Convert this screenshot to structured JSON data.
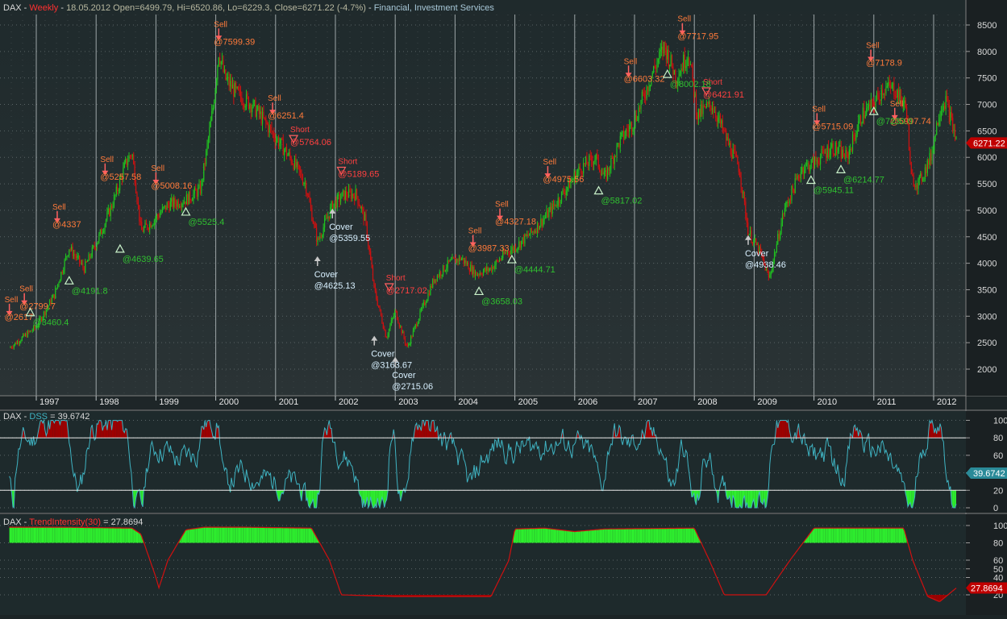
{
  "colors": {
    "up": "#20c020",
    "down": "#d01010",
    "sig": "#ff7a3a",
    "cov": "#d8f0ff",
    "buy": "#30c030",
    "dss": "#3fb3c2",
    "ti": "#d01010",
    "fill_hi": "#a00000",
    "fill_lo": "#2ef02e",
    "bg": "#1c2426"
  },
  "header": {
    "symbol": "DAX",
    "interval": "Weekly",
    "quote": "18.05.2012 Open=6499.79, Hi=6520.86, Lo=6229.3, Close=6271.22 (-4.7%)",
    "sector": "Financial, Investment Services"
  },
  "last_price": "6271.22",
  "chart_data": [
    {
      "type": "candlestick",
      "title": "DAX - Weekly",
      "x_years": [
        "1997",
        "1998",
        "1999",
        "2000",
        "2001",
        "2002",
        "2003",
        "2004",
        "2005",
        "2006",
        "2007",
        "2008",
        "2009",
        "2010",
        "2011",
        "2012"
      ],
      "ylim": [
        1500,
        8800
      ],
      "yticks": [
        2000,
        2500,
        3000,
        3500,
        4000,
        4500,
        5000,
        5500,
        6000,
        6500,
        7000,
        7500,
        8000,
        8500
      ],
      "price_path": [
        [
          1996.55,
          2400
        ],
        [
          1997.0,
          2800
        ],
        [
          1997.3,
          3400
        ],
        [
          1997.55,
          4300
        ],
        [
          1997.8,
          3900
        ],
        [
          1998.05,
          4500
        ],
        [
          1998.3,
          5200
        ],
        [
          1998.5,
          5900
        ],
        [
          1998.6,
          6100
        ],
        [
          1998.75,
          4600
        ],
        [
          1998.95,
          4800
        ],
        [
          1999.2,
          5100
        ],
        [
          1999.5,
          5200
        ],
        [
          1999.75,
          5400
        ],
        [
          1999.95,
          6900
        ],
        [
          2000.05,
          8000
        ],
        [
          2000.15,
          7500
        ],
        [
          2000.35,
          7200
        ],
        [
          2000.6,
          7000
        ],
        [
          2000.8,
          6700
        ],
        [
          2001.05,
          6300
        ],
        [
          2001.3,
          5900
        ],
        [
          2001.5,
          5500
        ],
        [
          2001.7,
          4400
        ],
        [
          2001.95,
          5100
        ],
        [
          2002.15,
          5300
        ],
        [
          2002.35,
          5300
        ],
        [
          2002.5,
          4800
        ],
        [
          2002.65,
          3500
        ],
        [
          2002.85,
          2600
        ],
        [
          2003.0,
          3100
        ],
        [
          2003.2,
          2400
        ],
        [
          2003.4,
          3000
        ],
        [
          2003.65,
          3700
        ],
        [
          2003.9,
          4000
        ],
        [
          2004.1,
          4100
        ],
        [
          2004.35,
          3800
        ],
        [
          2004.6,
          3900
        ],
        [
          2004.85,
          4200
        ],
        [
          2005.0,
          4300
        ],
        [
          2005.3,
          4600
        ],
        [
          2005.6,
          5000
        ],
        [
          2005.85,
          5400
        ],
        [
          2006.1,
          5800
        ],
        [
          2006.35,
          6000
        ],
        [
          2006.5,
          5600
        ],
        [
          2006.75,
          6300
        ],
        [
          2007.0,
          6700
        ],
        [
          2007.3,
          7600
        ],
        [
          2007.5,
          8100
        ],
        [
          2007.7,
          7500
        ],
        [
          2007.9,
          8000
        ],
        [
          2008.05,
          6800
        ],
        [
          2008.3,
          7000
        ],
        [
          2008.55,
          6300
        ],
        [
          2008.75,
          5800
        ],
        [
          2008.9,
          4600
        ],
        [
          2009.1,
          4200
        ],
        [
          2009.25,
          3700
        ],
        [
          2009.5,
          5000
        ],
        [
          2009.8,
          5800
        ],
        [
          2010.0,
          5900
        ],
        [
          2010.3,
          6200
        ],
        [
          2010.55,
          6000
        ],
        [
          2010.8,
          6800
        ],
        [
          2011.0,
          7000
        ],
        [
          2011.15,
          7300
        ],
        [
          2011.35,
          7300
        ],
        [
          2011.55,
          6900
        ],
        [
          2011.62,
          5600
        ],
        [
          2011.75,
          5500
        ],
        [
          2011.95,
          6000
        ],
        [
          2012.1,
          6900
        ],
        [
          2012.2,
          7100
        ],
        [
          2012.38,
          6300
        ]
      ],
      "signals": [
        {
          "kind": "sell",
          "label": "Sell",
          "price": "@7599.39",
          "x": 2000.05,
          "y": 8100
        },
        {
          "kind": "sell",
          "label": "Sell",
          "price": "@6251.4",
          "x": 2000.95,
          "y": 6700
        },
        {
          "kind": "sell",
          "label": "Sell",
          "price": "@5257.58",
          "x": 1998.15,
          "y": 5550
        },
        {
          "kind": "sell",
          "label": "Sell",
          "price": "@5008.16",
          "x": 1999.0,
          "y": 5380
        },
        {
          "kind": "sell",
          "label": "Sell",
          "price": "@4337",
          "x": 1997.35,
          "y": 4650
        },
        {
          "kind": "sell",
          "label": "Sell",
          "price": "@2799.7",
          "x": 1996.8,
          "y": 3100
        },
        {
          "kind": "sell",
          "label": "Sell",
          "price": "@2617",
          "x": 1996.55,
          "y": 2900
        },
        {
          "kind": "short",
          "label": "Short",
          "price": "@5764.06",
          "x": 2001.3,
          "y": 6200
        },
        {
          "kind": "short",
          "label": "Short",
          "price": "@5189.65",
          "x": 2002.1,
          "y": 5600
        },
        {
          "kind": "short",
          "label": "Short",
          "price": "@2717.02",
          "x": 2002.9,
          "y": 3400
        },
        {
          "kind": "sell",
          "label": "Sell",
          "price": "@3987.33",
          "x": 2004.3,
          "y": 4200
        },
        {
          "kind": "sell",
          "label": "Sell",
          "price": "@4327.18",
          "x": 2004.75,
          "y": 4700
        },
        {
          "kind": "sell",
          "label": "Sell",
          "price": "@4975.56",
          "x": 2005.55,
          "y": 5500
        },
        {
          "kind": "sell",
          "label": "Sell",
          "price": "@6603.32",
          "x": 2006.9,
          "y": 7400
        },
        {
          "kind": "sell",
          "label": "Sell",
          "price": "@7717.95",
          "x": 2007.8,
          "y": 8200
        },
        {
          "kind": "short",
          "label": "Short",
          "price": "@6421.91",
          "x": 2008.2,
          "y": 7100
        },
        {
          "kind": "sell",
          "label": "Sell",
          "price": "@5715.09",
          "x": 2010.05,
          "y": 6500
        },
        {
          "kind": "sell",
          "label": "Sell",
          "price": "@7178.9",
          "x": 2010.95,
          "y": 7700
        },
        {
          "kind": "sell",
          "label": "Sell",
          "price": "@5997.74",
          "x": 2011.35,
          "y": 6600
        },
        {
          "kind": "buy",
          "label": "Buy",
          "price": "@3460.4",
          "x": 1996.9,
          "y": 3100
        },
        {
          "kind": "buy",
          "label": "Buy",
          "price": "@4191.8",
          "x": 1997.55,
          "y": 3700
        },
        {
          "kind": "buy",
          "label": "Buy",
          "price": "@4639.65",
          "x": 1998.4,
          "y": 4300
        },
        {
          "kind": "buy",
          "label": "Buy",
          "price": "@5525.4",
          "x": 1999.5,
          "y": 5000
        },
        {
          "kind": "buy",
          "label": "Buy",
          "price": "@3658.03",
          "x": 2004.4,
          "y": 3500
        },
        {
          "kind": "buy",
          "label": "Buy",
          "price": "@4444.71",
          "x": 2004.95,
          "y": 4100
        },
        {
          "kind": "buy",
          "label": "Buy",
          "price": "@5817.02",
          "x": 2006.4,
          "y": 5400
        },
        {
          "kind": "buy",
          "label": "Buy",
          "price": "@8002.18",
          "x": 2007.55,
          "y": 7600
        },
        {
          "kind": "buy",
          "label": "Buy",
          "price": "@5945.11",
          "x": 2009.95,
          "y": 5600
        },
        {
          "kind": "buy",
          "label": "Buy",
          "price": "@6214.77",
          "x": 2010.45,
          "y": 5800
        },
        {
          "kind": "buy",
          "label": "Buy",
          "price": "@7230.0",
          "x": 2011.0,
          "y": 6900
        },
        {
          "kind": "cover",
          "label": "Cover",
          "price": "@4625.13",
          "x": 2001.7,
          "y": 4100
        },
        {
          "kind": "cover",
          "label": "Cover",
          "price": "@5359.55",
          "x": 2001.95,
          "y": 5000
        },
        {
          "kind": "cover",
          "label": "Cover",
          "price": "@3163.67",
          "x": 2002.65,
          "y": 2600
        },
        {
          "kind": "cover",
          "label": "Cover",
          "price": "@2715.06",
          "x": 2003.0,
          "y": 2200
        },
        {
          "kind": "cover",
          "label": "Cover",
          "price": "@4938.46",
          "x": 2008.9,
          "y": 4500
        }
      ]
    },
    {
      "type": "line",
      "title": "DAX - DSS = 39.6742",
      "indicator": "DSS",
      "value": "39.6742",
      "ylim": [
        0,
        105
      ],
      "yticks": [
        0,
        20,
        40,
        60,
        80,
        100
      ],
      "thresholds": [
        20,
        80
      ]
    },
    {
      "type": "area",
      "title": "DAX - TrendIntensity(30) = 27.8694",
      "indicator": "TrendIntensity(30)",
      "value": "27.8694",
      "ylim": [
        0,
        105
      ],
      "yticks": [
        20,
        40,
        50,
        60,
        80,
        100
      ],
      "thresholds": [
        20,
        80
      ],
      "path": [
        [
          1996.55,
          98
        ],
        [
          1997.5,
          98
        ],
        [
          1998.6,
          97
        ],
        [
          1998.75,
          90
        ],
        [
          1999.0,
          40
        ],
        [
          1999.05,
          28
        ],
        [
          1999.2,
          60
        ],
        [
          1999.5,
          95
        ],
        [
          1999.8,
          98
        ],
        [
          2000.5,
          98
        ],
        [
          2001.6,
          97
        ],
        [
          2001.9,
          60
        ],
        [
          2002.1,
          20
        ],
        [
          2003.0,
          18
        ],
        [
          2004.6,
          18
        ],
        [
          2004.9,
          60
        ],
        [
          2005.0,
          96
        ],
        [
          2005.5,
          97
        ],
        [
          2006.0,
          93
        ],
        [
          2006.5,
          96
        ],
        [
          2008.0,
          97
        ],
        [
          2008.25,
          60
        ],
        [
          2008.5,
          20
        ],
        [
          2009.2,
          20
        ],
        [
          2009.6,
          60
        ],
        [
          2010.0,
          97
        ],
        [
          2011.5,
          97
        ],
        [
          2011.65,
          60
        ],
        [
          2011.9,
          18
        ],
        [
          2012.1,
          12
        ],
        [
          2012.38,
          28
        ]
      ]
    }
  ]
}
